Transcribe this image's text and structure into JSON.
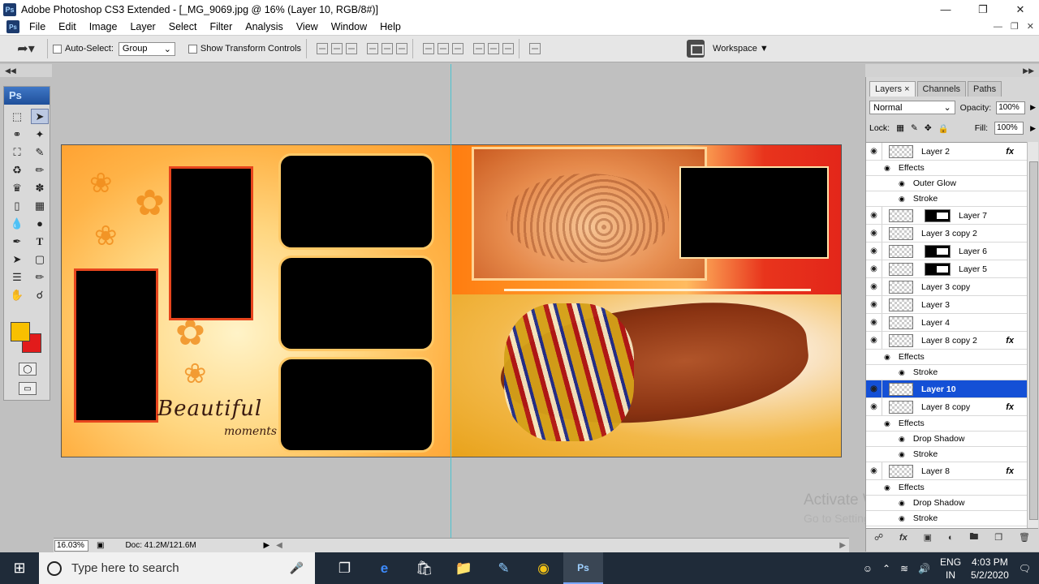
{
  "window": {
    "title": "Adobe Photoshop CS3 Extended - [_MG_9069.jpg @ 16% (Layer 10, RGB/8#)]",
    "logo": "Ps"
  },
  "menu": [
    "File",
    "Edit",
    "Image",
    "Layer",
    "Select",
    "Filter",
    "Analysis",
    "View",
    "Window",
    "Help"
  ],
  "options": {
    "auto_select_label": "Auto-Select:",
    "auto_select_value": "Group",
    "transform_label": "Show Transform Controls",
    "workspace_label": "Workspace"
  },
  "toolbox": {
    "header": "Ps",
    "foreground_color": "#f8c000",
    "background_color": "#e21b1b"
  },
  "canvas": {
    "script_text": "Beautiful",
    "script_text_2": "moments"
  },
  "watermark": {
    "line1": "Activate Windows",
    "line2": "Go to Settings to activate Windows."
  },
  "status": {
    "zoom": "16.03%",
    "doc": "Doc: 41.2M/121.6M"
  },
  "layers_panel": {
    "tabs": [
      "Layers",
      "Channels",
      "Paths"
    ],
    "blend_mode": "Normal",
    "opacity_label": "Opacity:",
    "opacity": "100%",
    "lock_label": "Lock:",
    "fill_label": "Fill:",
    "fill": "100%",
    "rows": [
      {
        "kind": "layer",
        "name": "Layer 2",
        "fx": "fx"
      },
      {
        "kind": "effects",
        "name": "Effects"
      },
      {
        "kind": "effect",
        "name": "Outer Glow"
      },
      {
        "kind": "effect",
        "name": "Stroke"
      },
      {
        "kind": "layer-mask",
        "name": "Layer 7"
      },
      {
        "kind": "layer",
        "name": "Layer 3 copy 2"
      },
      {
        "kind": "layer-mask",
        "name": "Layer 6"
      },
      {
        "kind": "layer-mask",
        "name": "Layer 5"
      },
      {
        "kind": "layer",
        "name": "Layer 3 copy"
      },
      {
        "kind": "layer",
        "name": "Layer 3"
      },
      {
        "kind": "layer",
        "name": "Layer 4"
      },
      {
        "kind": "layer",
        "name": "Layer 8 copy 2",
        "fx": "fx"
      },
      {
        "kind": "effects",
        "name": "Effects"
      },
      {
        "kind": "effect",
        "name": "Stroke"
      },
      {
        "kind": "layer",
        "name": "Layer 10",
        "selected": true
      },
      {
        "kind": "layer",
        "name": "Layer 8 copy",
        "fx": "fx"
      },
      {
        "kind": "effects",
        "name": "Effects"
      },
      {
        "kind": "effect",
        "name": "Drop Shadow"
      },
      {
        "kind": "effect",
        "name": "Stroke"
      },
      {
        "kind": "layer",
        "name": "Layer 8",
        "fx": "fx"
      },
      {
        "kind": "effects",
        "name": "Effects"
      },
      {
        "kind": "effect",
        "name": "Drop Shadow"
      },
      {
        "kind": "effect",
        "name": "Stroke"
      }
    ]
  },
  "taskbar": {
    "search_placeholder": "Type here to search",
    "lang_line1": "ENG",
    "lang_line2": "IN",
    "time": "4:03 PM",
    "date": "5/2/2020"
  }
}
